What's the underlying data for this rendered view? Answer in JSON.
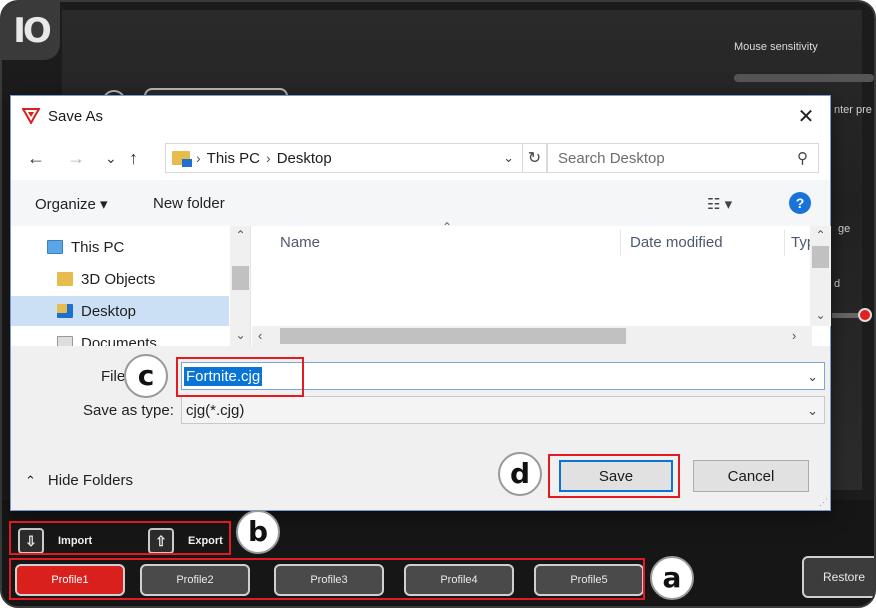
{
  "app": {
    "logo_text": "IO",
    "mouse_sensitivity_label": "Mouse sensitivity",
    "side_labels": [
      "nter pre",
      "ge",
      "d"
    ],
    "import_label": "Import",
    "export_label": "Export",
    "profiles": [
      "Profile1",
      "Profile2",
      "Profile3",
      "Profile4",
      "Profile5"
    ],
    "active_profile": "Profile1",
    "restore_label": "Restore",
    "accent_color": "#d9201c"
  },
  "callouts": {
    "a": "a",
    "b": "b",
    "c": "c",
    "d": "d",
    "highlight_color": "#e21b23"
  },
  "dialog": {
    "title": "Save As",
    "close_glyph": "✕",
    "nav": {
      "back": "←",
      "forward": "→",
      "recent": "⌄",
      "up": "↑",
      "breadcrumb": [
        "This PC",
        "Desktop"
      ],
      "refresh": "↻",
      "search_placeholder": "Search Desktop"
    },
    "toolbar": {
      "organize": "Organize ▾",
      "new_folder": "New folder",
      "view": "☷ ▾",
      "help": "?"
    },
    "tree": [
      "This PC",
      "3D Objects",
      "Desktop",
      "Documents"
    ],
    "selected_tree_item": "Desktop",
    "columns": [
      "Name",
      "Date modified",
      "Typ"
    ],
    "file_name_label": "File name:",
    "file_name_label_visible": "File",
    "file_name_value": "Fortnite.cjg",
    "save_type_label": "Save as type:",
    "save_type_value": "cjg(*.cjg)",
    "hide_folders": "Hide Folders",
    "save_button": "Save",
    "cancel_button": "Cancel"
  }
}
